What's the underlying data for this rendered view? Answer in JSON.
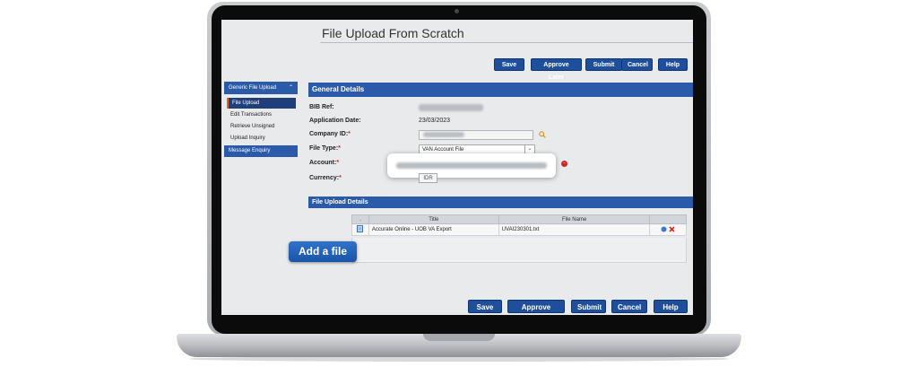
{
  "page": {
    "title": "File Upload From Scratch"
  },
  "toolbar": {
    "save": "Save",
    "approve_later": "Approve Later",
    "submit": "Submit",
    "cancel": "Cancel",
    "help": "Help"
  },
  "sidebar": {
    "group": "Generic File Upload",
    "items": [
      "File Upload",
      "Edit Transactions",
      "Retrieve Unsigned",
      "Upload Inquiry"
    ],
    "group2": "Message Enquiry"
  },
  "general": {
    "heading": "General Details",
    "bib_ref_label": "BIB Ref:",
    "application_date_label": "Application Date:",
    "application_date": "23/03/2023",
    "company_id_label": "Company ID:",
    "file_type_label": "File Type:",
    "file_type_value": "VAN Account File",
    "account_label": "Account:",
    "currency_label": "Currency:",
    "currency_value": "IDR",
    "required_mark": "*"
  },
  "upload": {
    "heading": "File Upload Details",
    "columns": [
      ".",
      "Title",
      "File Name"
    ],
    "rows": [
      {
        "title": "Accurate Online - UOB VA Export",
        "file_name": "UVAI230301.txt"
      }
    ]
  },
  "callout": {
    "add_file": "Add a file"
  },
  "icons": {
    "search": "search-icon",
    "error": "error-icon",
    "file": "file-icon",
    "edit": "edit-icon",
    "delete": "delete-icon"
  },
  "colors": {
    "primary": "#2b5ba8",
    "button": "#1f4f9a",
    "error": "#c62828"
  }
}
